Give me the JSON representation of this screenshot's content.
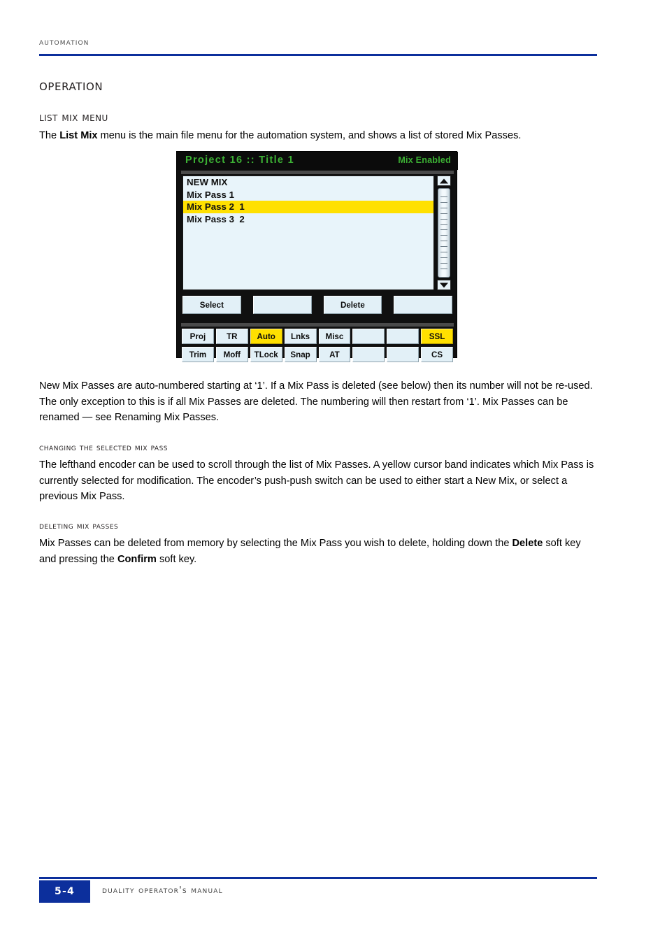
{
  "page": {
    "running_head": "Automation",
    "accent_color": "#0c2f9c",
    "footer": {
      "page_number": "5-4",
      "manual_title": "Duality Operator's Manual"
    }
  },
  "headings": {
    "h1": "Operation",
    "h2": "List Mix Menu",
    "h3_changing": "Changing the selected Mix Pass",
    "h3_deleting": "Deleting Mix Passes"
  },
  "paragraphs": {
    "intro_pre": "The ",
    "intro_bold": "List Mix",
    "intro_post": " menu is the main file menu for the automation system, and shows a list of stored Mix Passes.",
    "auto_numbering": "New Mix Passes are auto-numbered starting at ‘1’. If a Mix Pass is deleted (see below) then its number will not be re-used. The only exception to this is if all Mix Passes are deleted. The numbering will then restart from ‘1’. Mix Passes can be renamed — see Renaming Mix Passes.",
    "changing": "The lefthand encoder can be used to scroll through the list of Mix Passes. A yellow cursor band indicates which Mix Pass is currently selected for modification. The encoder’s push-push switch can be used to either start a New Mix, or select a previous Mix Pass.",
    "deleting_pre": "Mix Passes can be deleted from memory by selecting the Mix Pass you wish to delete, holding down the ",
    "deleting_bold1": "Delete",
    "deleting_mid": " soft key and pressing the ",
    "deleting_bold2": "Confirm",
    "deleting_post": " soft key."
  },
  "device": {
    "title_bar": {
      "left": "Project 16 :: Title 1",
      "right": "Mix Enabled",
      "text_color": "#3cb034",
      "background": "#0b0b0b"
    },
    "list": {
      "background": "#e8f4fa",
      "selected_color": "#ffe000",
      "rows": [
        {
          "label": "NEW MIX",
          "selected": false
        },
        {
          "label": "Mix Pass 1",
          "selected": false
        },
        {
          "label": "Mix Pass 2  1",
          "selected": true
        },
        {
          "label": "Mix Pass 3  2",
          "selected": false
        },
        {
          "label": "",
          "selected": false
        },
        {
          "label": "",
          "selected": false
        },
        {
          "label": "",
          "selected": false
        },
        {
          "label": "",
          "selected": false
        },
        {
          "label": "",
          "selected": false
        }
      ]
    },
    "scrollbar": {
      "up_icon": "scroll-up-arrow-icon",
      "down_icon": "scroll-down-arrow-icon",
      "tick_count": 14
    },
    "soft_keys": [
      {
        "label": "Select"
      },
      {
        "label": ""
      },
      {
        "label": "Delete"
      },
      {
        "label": ""
      }
    ],
    "function_keys": {
      "row1": [
        {
          "label": "Proj",
          "active": false
        },
        {
          "label": "TR",
          "active": false
        },
        {
          "label": "Auto",
          "active": true
        },
        {
          "label": "Lnks",
          "active": false
        },
        {
          "label": "Misc",
          "active": false
        },
        {
          "label": "",
          "active": false
        },
        {
          "label": "",
          "active": false
        },
        {
          "label": "SSL",
          "active": true
        }
      ],
      "row2": [
        {
          "label": "Trim",
          "active": false
        },
        {
          "label": "Moff",
          "active": false
        },
        {
          "label": "TLock",
          "active": false
        },
        {
          "label": "Snap",
          "active": false
        },
        {
          "label": "AT",
          "active": false
        },
        {
          "label": "",
          "active": false
        },
        {
          "label": "",
          "active": false
        },
        {
          "label": "CS",
          "active": false
        }
      ]
    }
  }
}
